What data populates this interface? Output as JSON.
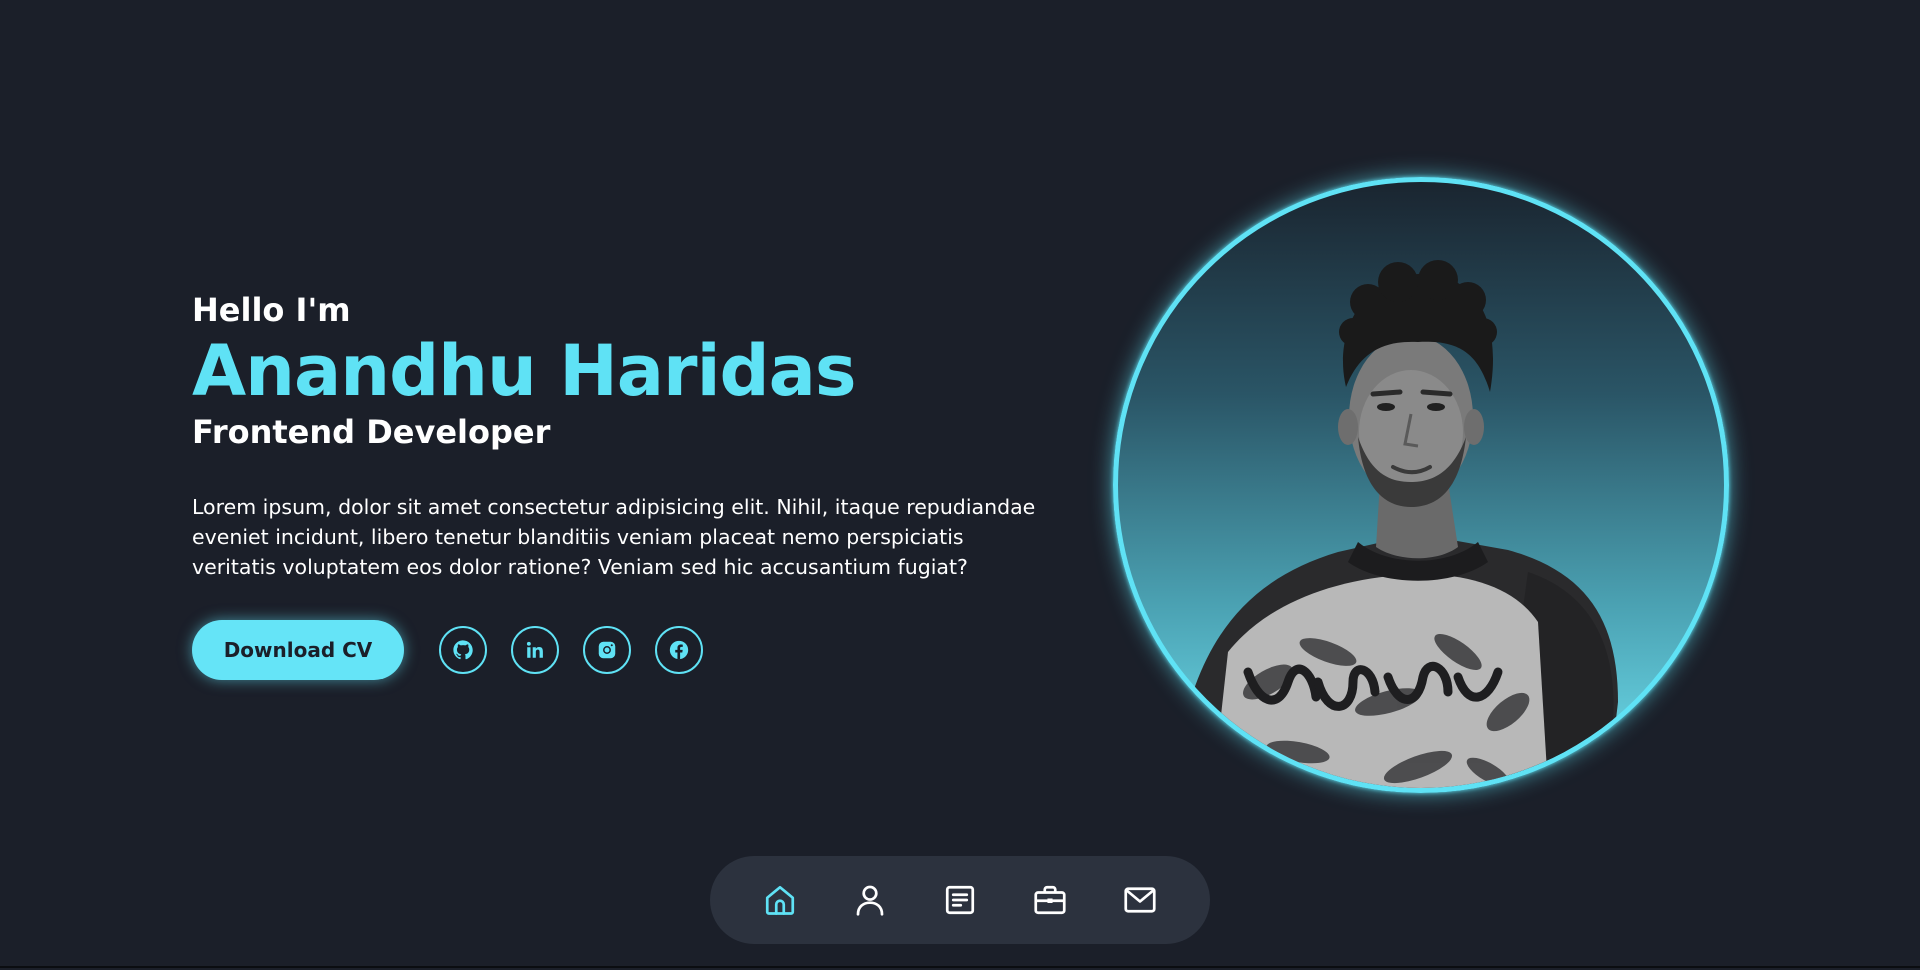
{
  "hero": {
    "greeting": "Hello I'm",
    "name": "Anandhu Haridas",
    "role": "Frontend Developer",
    "bio": "Lorem ipsum, dolor sit amet consectetur adipisicing elit. Nihil, itaque repudiandae eveniet incidunt, libero tenetur blanditiis veniam placeat nemo perspiciatis veritatis voluptatem eos dolor ratione? Veniam sed hic accusantium fugiat?",
    "cv_button_label": "Download CV"
  },
  "socials": [
    {
      "icon": "github-icon"
    },
    {
      "icon": "linkedin-icon"
    },
    {
      "icon": "instagram-icon"
    },
    {
      "icon": "facebook-icon"
    }
  ],
  "portrait": {
    "description_icon": "profile-photo"
  },
  "bottom_nav": {
    "items": [
      {
        "icon": "home-icon",
        "active": true
      },
      {
        "icon": "user-icon",
        "active": false
      },
      {
        "icon": "document-icon",
        "active": false
      },
      {
        "icon": "briefcase-icon",
        "active": false
      },
      {
        "icon": "mail-icon",
        "active": false
      }
    ]
  },
  "colors": {
    "background": "#1b1f29",
    "accent": "#5fe2f5",
    "nav_background": "#2c323e",
    "text": "#ffffff"
  }
}
